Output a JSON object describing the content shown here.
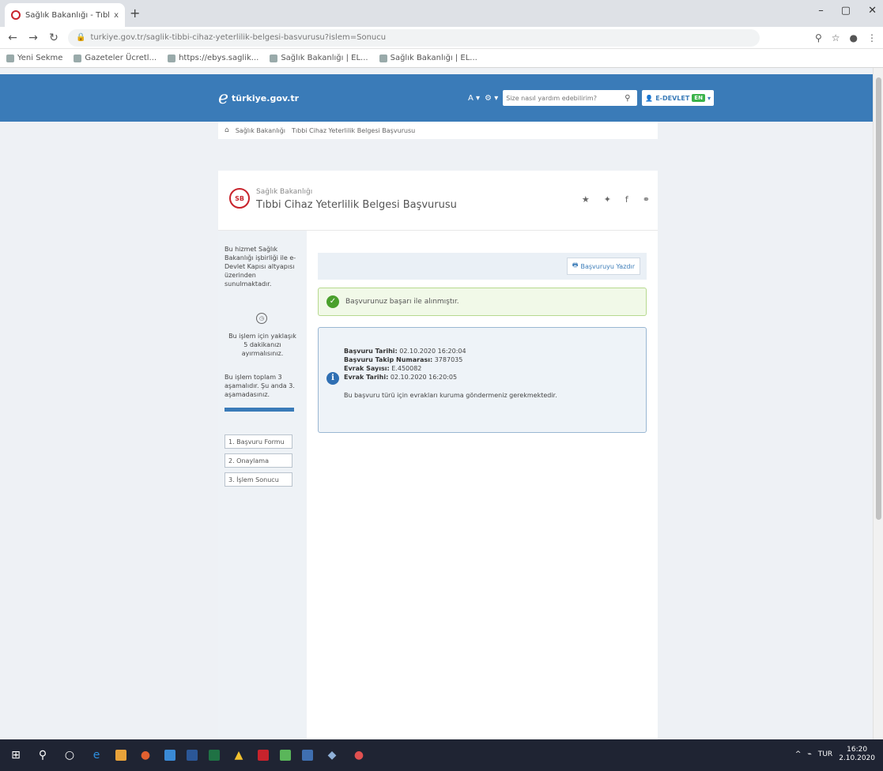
{
  "browser": {
    "tab_title": "Sağlık Bakanlığı - Tıbbi Cihaz Ye...",
    "tab_close": "x",
    "new_tab": "+",
    "url": "turkiye.gov.tr/saglik-tibbi-cihaz-yeterlilik-belgesi-basvurusu?islem=Sonucu",
    "bookmarks": [
      {
        "label": "Yeni Sekme"
      },
      {
        "label": "Gazeteler Ücretl..."
      },
      {
        "label": "https://ebys.saglik..."
      },
      {
        "label": "Sağlık Bakanlığı | EL..."
      },
      {
        "label": "Sağlık Bakanlığı | EL..."
      }
    ]
  },
  "header": {
    "logo_text": "türkiye.gov.tr",
    "search_placeholder": "Size nasıl yardım edebilirim?",
    "login_label": "E-DEVLET",
    "login_badge": "EN"
  },
  "breadcrumb": {
    "items": [
      "Sağlık Bakanlığı",
      "Tıbbi Cihaz Yeterlilik Belgesi Başvurusu"
    ]
  },
  "service": {
    "institution": "Sağlık Bakanlığı",
    "title": "Tıbbi Cihaz Yeterlilik Belgesi Başvurusu",
    "seal_text": "SB"
  },
  "sidebar": {
    "description": "Bu hizmet Sağlık Bakanlığı işbirliği ile e-Devlet Kapısı altyapısı üzerinden sunulmaktadır.",
    "time_note": "Bu işlem için yaklaşık 5 dakikanızı ayırmalısınız.",
    "steps_note": "Bu işlem toplam 3 aşamalıdır. Şu anda 3. aşamadasınız.",
    "progress": 1.0,
    "steps": [
      {
        "label": "1. Başvuru Formu"
      },
      {
        "label": "2. Onaylama"
      },
      {
        "label": "3. İşlem Sonucu"
      }
    ]
  },
  "actions": {
    "print_label": "Başvuruyu Yazdır"
  },
  "success": {
    "message": "Başvurunuz başarı ile alınmıştır."
  },
  "info": {
    "date_label": "Başvuru Tarihi:",
    "date_value": "02.10.2020 16:20:04",
    "tracking_label": "Başvuru Takip Numarası:",
    "tracking_value": "3787035",
    "doc_no_label": "Evrak Sayısı:",
    "doc_no_value": "E.450082",
    "doc_date_label": "Evrak Tarihi:",
    "doc_date_value": "02.10.2020 16:20:05",
    "note": "Bu başvuru türü için evrakları kuruma göndermeniz gerekmektedir."
  },
  "taskbar": {
    "time": "16:20",
    "date": "2.10.2020",
    "lang": "TUR"
  }
}
